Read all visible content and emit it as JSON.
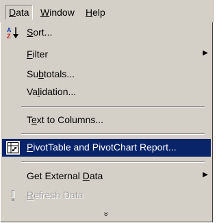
{
  "menubar": {
    "items": [
      {
        "label": "Data",
        "mnemonic": "D",
        "rest": "ata"
      },
      {
        "label": "Window",
        "mnemonic": "W",
        "rest": "indow"
      },
      {
        "label": "Help",
        "mnemonic": "H",
        "rest": "elp"
      }
    ]
  },
  "menu": {
    "sort": {
      "pre": "",
      "mn": "S",
      "post": "ort..."
    },
    "filter": {
      "pre": "",
      "mn": "F",
      "post": "ilter"
    },
    "subtotals": {
      "pre": "Su",
      "mn": "b",
      "post": "totals..."
    },
    "validation": {
      "pre": "Va",
      "mn": "l",
      "post": "idation..."
    },
    "text_to_columns": {
      "pre": "T",
      "mn": "e",
      "post": "xt to Columns..."
    },
    "pivot": {
      "pre": "",
      "mn": "P",
      "post": "ivotTable and PivotChart Report..."
    },
    "external": {
      "pre": "Get External ",
      "mn": "D",
      "post": "ata"
    },
    "refresh": {
      "pre": "",
      "mn": "R",
      "post": "efresh Data"
    },
    "expand_glyph": "»"
  },
  "colors": {
    "menu_bg": "#d4d0c8",
    "highlight_bg": "#0a246a",
    "highlight_text": "#ffffff",
    "disabled_text": "#a0a0a0"
  },
  "icons": {
    "sort": "sort-az-icon",
    "pivot": "pivot-table-icon",
    "refresh": "refresh-exclamation-icon",
    "submenu": "submenu-arrow-icon",
    "expand": "expand-chevron-icon"
  }
}
